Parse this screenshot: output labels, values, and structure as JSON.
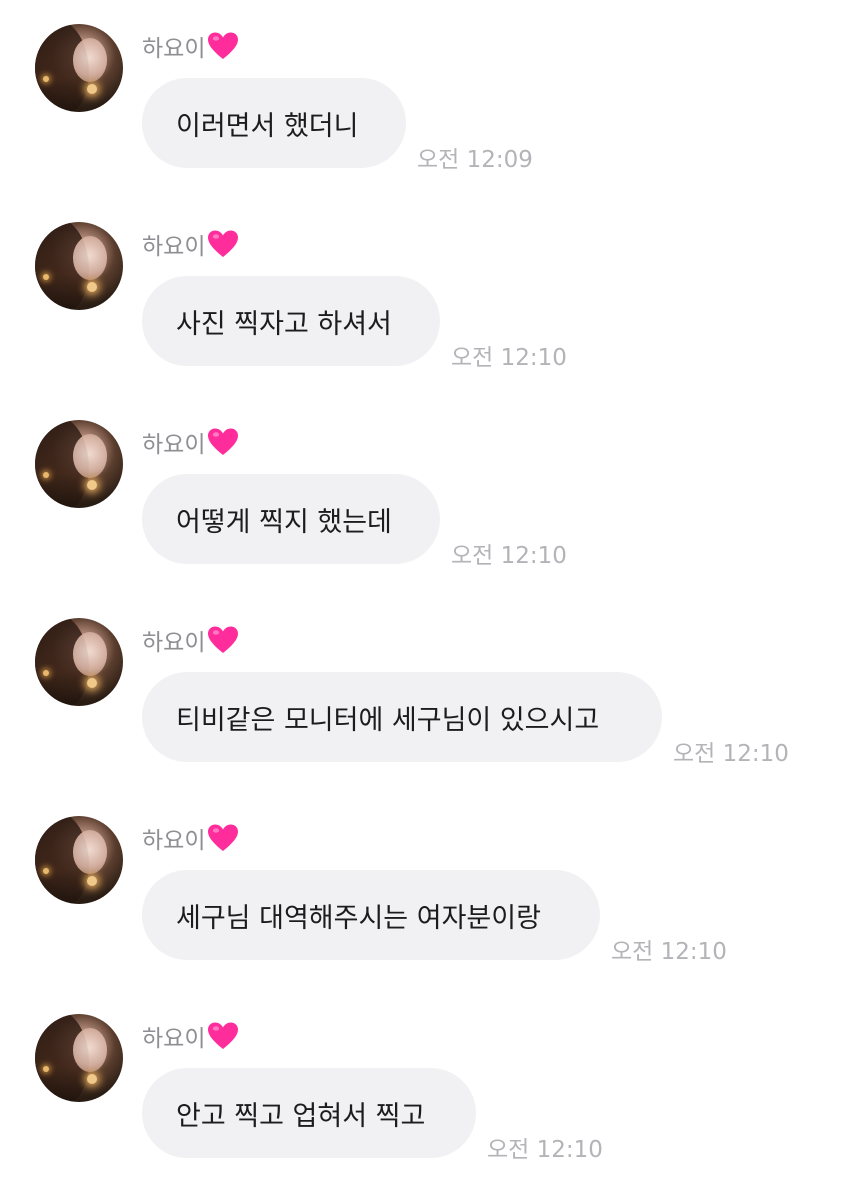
{
  "messages": [
    {
      "sender": "하요이",
      "sender_icon": "heart-icon",
      "text": "이러면서 했더니",
      "time": "오전 12:09"
    },
    {
      "sender": "하요이",
      "sender_icon": "heart-icon",
      "text": "사진 찍자고 하셔서",
      "time": "오전 12:10"
    },
    {
      "sender": "하요이",
      "sender_icon": "heart-icon",
      "text": "어떻게 찍지 했는데",
      "time": "오전 12:10"
    },
    {
      "sender": "하요이",
      "sender_icon": "heart-icon",
      "text": "티비같은 모니터에 세구님이 있으시고",
      "time": "오전 12:10"
    },
    {
      "sender": "하요이",
      "sender_icon": "heart-icon",
      "text": "세구님 대역해주시는 여자분이랑",
      "time": "오전 12:10"
    },
    {
      "sender": "하요이",
      "sender_icon": "heart-icon",
      "text": "안고 찍고 업혀서 찍고",
      "time": "오전 12:10"
    }
  ],
  "colors": {
    "bubble": "#f1f1f3",
    "heart": "#ff2d9b",
    "name": "#8e8e93",
    "time": "#b3b3b8",
    "text": "#1c1c1e"
  }
}
